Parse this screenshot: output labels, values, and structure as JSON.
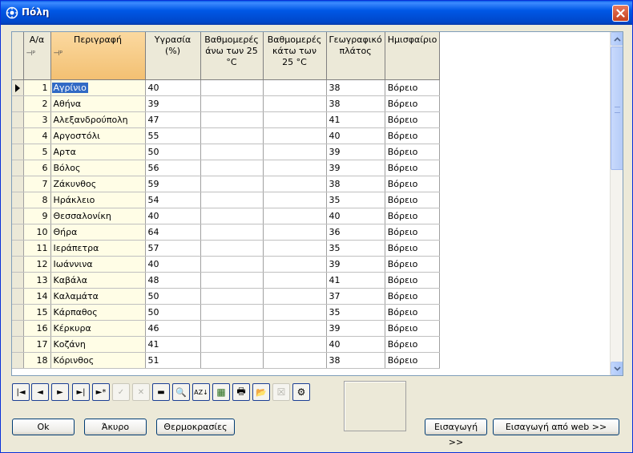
{
  "window": {
    "title": "Πόλη"
  },
  "grid": {
    "columns": [
      "Α/α",
      "Περιγραφή",
      "Υγρασία (%)",
      "Βαθμομερές άνω των 25 °C",
      "Βαθμομερές κάτω των 25 °C",
      "Γεωγραφικό πλάτος",
      "Ημισφαίριο"
    ],
    "pin_marker": "⊣ᵖ",
    "rows": [
      {
        "id": "1",
        "name": "Αγρίνιο",
        "humidity": "40",
        "dd_above": "",
        "dd_below": "",
        "lat": "38",
        "hemisphere": "Βόρειο"
      },
      {
        "id": "2",
        "name": "Αθήνα",
        "humidity": "39",
        "dd_above": "",
        "dd_below": "",
        "lat": "38",
        "hemisphere": "Βόρειο"
      },
      {
        "id": "3",
        "name": "Αλεξανδρούπολη",
        "humidity": "47",
        "dd_above": "",
        "dd_below": "",
        "lat": "41",
        "hemisphere": "Βόρειο"
      },
      {
        "id": "4",
        "name": "Αργοστόλι",
        "humidity": "55",
        "dd_above": "",
        "dd_below": "",
        "lat": "40",
        "hemisphere": "Βόρειο"
      },
      {
        "id": "5",
        "name": "Αρτα",
        "humidity": "50",
        "dd_above": "",
        "dd_below": "",
        "lat": "39",
        "hemisphere": "Βόρειο"
      },
      {
        "id": "6",
        "name": "Βόλος",
        "humidity": "56",
        "dd_above": "",
        "dd_below": "",
        "lat": "39",
        "hemisphere": "Βόρειο"
      },
      {
        "id": "7",
        "name": "Ζάκυνθος",
        "humidity": "59",
        "dd_above": "",
        "dd_below": "",
        "lat": "38",
        "hemisphere": "Βόρειο"
      },
      {
        "id": "8",
        "name": "Ηράκλειο",
        "humidity": "54",
        "dd_above": "",
        "dd_below": "",
        "lat": "35",
        "hemisphere": "Βόρειο"
      },
      {
        "id": "9",
        "name": "Θεσσαλονίκη",
        "humidity": "40",
        "dd_above": "",
        "dd_below": "",
        "lat": "40",
        "hemisphere": "Βόρειο"
      },
      {
        "id": "10",
        "name": "Θήρα",
        "humidity": "64",
        "dd_above": "",
        "dd_below": "",
        "lat": "36",
        "hemisphere": "Βόρειο"
      },
      {
        "id": "11",
        "name": "Ιεράπετρα",
        "humidity": "57",
        "dd_above": "",
        "dd_below": "",
        "lat": "35",
        "hemisphere": "Βόρειο"
      },
      {
        "id": "12",
        "name": "Ιωάννινα",
        "humidity": "40",
        "dd_above": "",
        "dd_below": "",
        "lat": "39",
        "hemisphere": "Βόρειο"
      },
      {
        "id": "13",
        "name": "Καβάλα",
        "humidity": "48",
        "dd_above": "",
        "dd_below": "",
        "lat": "41",
        "hemisphere": "Βόρειο"
      },
      {
        "id": "14",
        "name": "Καλαμάτα",
        "humidity": "50",
        "dd_above": "",
        "dd_below": "",
        "lat": "37",
        "hemisphere": "Βόρειο"
      },
      {
        "id": "15",
        "name": "Κάρπαθος",
        "humidity": "50",
        "dd_above": "",
        "dd_below": "",
        "lat": "35",
        "hemisphere": "Βόρειο"
      },
      {
        "id": "16",
        "name": "Κέρκυρα",
        "humidity": "46",
        "dd_above": "",
        "dd_below": "",
        "lat": "39",
        "hemisphere": "Βόρειο"
      },
      {
        "id": "17",
        "name": "Κοζάνη",
        "humidity": "41",
        "dd_above": "",
        "dd_below": "",
        "lat": "40",
        "hemisphere": "Βόρειο"
      },
      {
        "id": "18",
        "name": "Κόρινθος",
        "humidity": "51",
        "dd_above": "",
        "dd_below": "",
        "lat": "38",
        "hemisphere": "Βόρειο"
      }
    ]
  },
  "navigator": {
    "first": "|◄",
    "prior": "◄",
    "next": "►",
    "last": "►|",
    "insert": "►*",
    "post": "✓",
    "cancel": "✕",
    "delete": "▬",
    "find": "🔍",
    "sort": "AZ↓",
    "filter": "▦",
    "print": "🖶",
    "open": "📂",
    "clear": "☒",
    "tools": "⚙"
  },
  "buttons": {
    "ok": "Ok",
    "cancel": "Άκυρο",
    "temperatures": "Θερμοκρασίες",
    "import": "Εισαγωγή >>",
    "import_web": "Εισαγωγή από web >>"
  },
  "colors": {
    "title_bar": "#0058e6",
    "selected": "#316ac5",
    "sorted_header": "#f3c072",
    "key_column": "#fffde6"
  }
}
